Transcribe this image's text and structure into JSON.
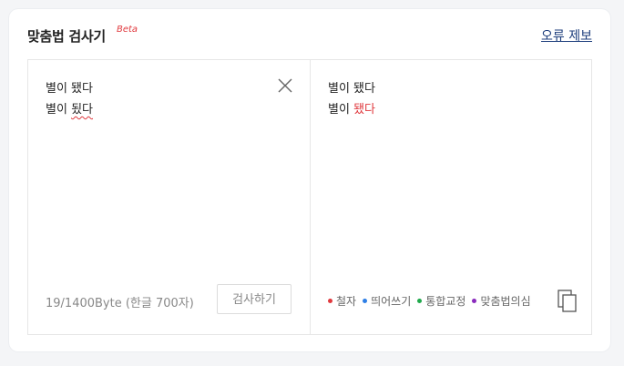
{
  "header": {
    "title": "맞춤법 검사기",
    "beta": "Beta",
    "report_link": "오류 제보"
  },
  "input": {
    "line1": "별이 됐다",
    "line2_prefix": "별이 ",
    "line2_error": "됬다",
    "char_count": "19/1400Byte (한글 700자)",
    "check_button": "검사하기"
  },
  "output": {
    "line1": "별이 됐다",
    "line2_prefix": "별이 ",
    "line2_corrected": "됐다"
  },
  "legend": [
    {
      "label": "철자",
      "color": "#e0393e"
    },
    {
      "label": "띄어쓰기",
      "color": "#2e7fe6"
    },
    {
      "label": "통합교정",
      "color": "#1fa94b"
    },
    {
      "label": "맞춤법의심",
      "color": "#8a2bbd"
    }
  ],
  "colors": {
    "error": "#e0393e",
    "link": "#1f3f7d"
  },
  "icons": {
    "clear": "close-icon",
    "copy": "copy-icon"
  }
}
